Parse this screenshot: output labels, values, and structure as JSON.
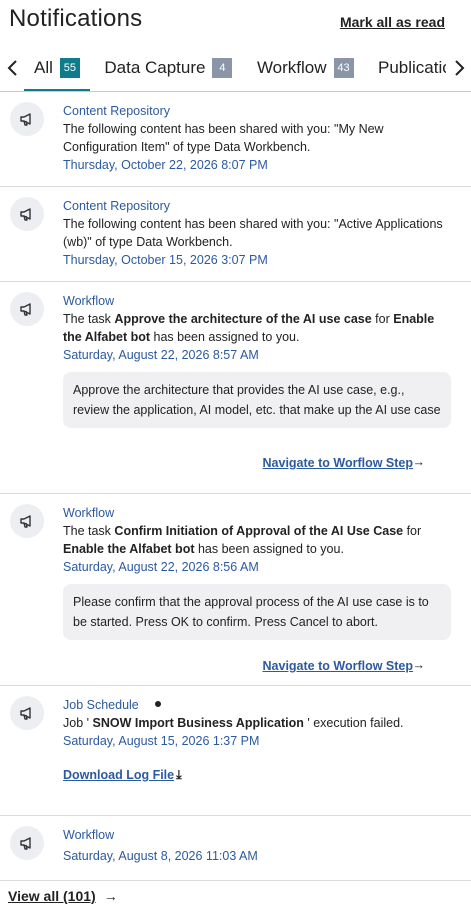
{
  "header": {
    "title": "Notifications",
    "mark_all": "Mark all as read"
  },
  "tabs": [
    {
      "label": "All",
      "count": "55"
    },
    {
      "label": "Data Capture",
      "count": "4"
    },
    {
      "label": "Workflow",
      "count": "43"
    },
    {
      "label": "Publicatio",
      "count": ""
    }
  ],
  "colors": {
    "accent": "#0f7c8c",
    "link": "#2c5aa0",
    "badge_inactive": "#8a96a8"
  },
  "notifications": [
    {
      "source": "Content Repository",
      "message": "The following content has been shared with you: \"My New Configuration Item\" of type Data Workbench.",
      "date": "Thursday, October 22, 2026 8:07 PM",
      "icon": "megaphone-icon"
    },
    {
      "source": "Content Repository",
      "message": "The following content has been shared with you: \"Active Applications (wb)\" of type Data Workbench.",
      "date": "Thursday, October 15, 2026 3:07 PM",
      "icon": "megaphone-icon"
    },
    {
      "source": "Workflow",
      "msg_pre": "The task ",
      "msg_task": "Approve the architecture of the AI use case",
      "msg_mid": " for ",
      "msg_obj": "Enable the Alfabet bot",
      "msg_post": " has been assigned to you.",
      "date": "Saturday, August 22, 2026 8:57 AM",
      "detail": "Approve the architecture that provides the AI use case, e.g., review the application, AI model, etc. that make up the AI use case",
      "link": "Navigate to Worflow Step",
      "icon": "megaphone-icon"
    },
    {
      "source": "Workflow",
      "msg_pre": "The task ",
      "msg_task": "Confirm Initiation of Approval of the AI Use Case",
      "msg_mid": " for ",
      "msg_obj": "Enable the Alfabet bot",
      "msg_post": " has been assigned to you.",
      "date": "Saturday, August 22, 2026 8:56 AM",
      "detail": "Please confirm that the approval process of the AI use case is to be started. Press OK to confirm. Press Cancel to abort.",
      "link": "Navigate to Worflow Step",
      "icon": "megaphone-icon"
    },
    {
      "source": "Job Schedule",
      "msg_pre": "Job ' ",
      "msg_job": "SNOW Import Business Application",
      "msg_post": " ' execution failed.",
      "date": "Saturday, August 15, 2026 1:37 PM",
      "link": "Download Log File",
      "icon": "megaphone-icon"
    },
    {
      "source": "Workflow",
      "date": "Saturday, August 8, 2026 11:03 AM",
      "icon": "megaphone-icon"
    }
  ],
  "footer": {
    "view_all": "View all (101)"
  }
}
